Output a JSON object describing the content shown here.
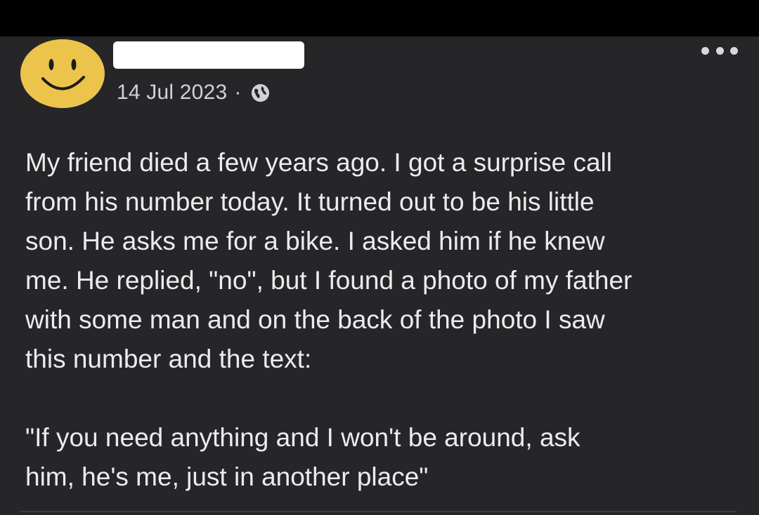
{
  "post": {
    "timestamp": "14 Jul 2023",
    "separator": "·",
    "privacy_icon": "globe-icon",
    "author_avatar": "smiley-face-avatar",
    "author_name_redacted": true,
    "more_icon": "three-dots-icon",
    "paragraphs": [
      "My friend died a few years ago. I got a surprise call\nfrom his number today. It turned out to be his little\nson. He asks me for a bike. I asked him if he knew\nme. He replied, \"no\", but I found a photo of my father\nwith some man and on the back of the photo I saw\nthis number and the text:",
      "\"If you need anything and I won't be around, ask\nhim, he's me, just in another place\""
    ]
  },
  "colors": {
    "background": "#000000",
    "card": "#262628",
    "text": "#ececee",
    "meta_text": "#d2d2d4",
    "avatar": "#ecc44c"
  }
}
